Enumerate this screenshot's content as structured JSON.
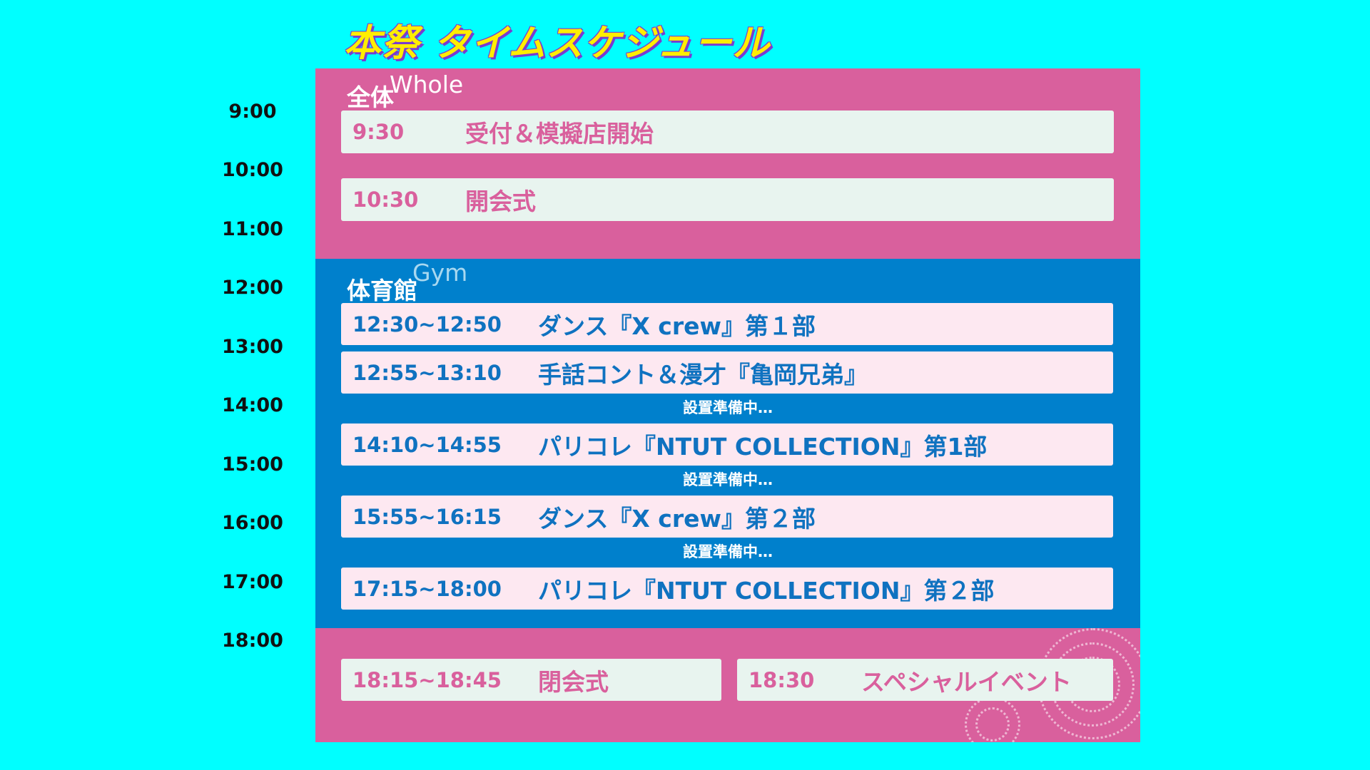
{
  "title": "本祭 タイムスケジュール",
  "hours": [
    "9:00",
    "10:00",
    "11:00",
    "12:00",
    "13:00",
    "14:00",
    "15:00",
    "16:00",
    "17:00",
    "18:00"
  ],
  "whole": {
    "label": "全体",
    "sublabel": "Whole",
    "events": [
      {
        "time": "9:30",
        "name": "受付＆模擬店開始"
      },
      {
        "time": "10:30",
        "name": "開会式"
      }
    ]
  },
  "gym": {
    "label": "体育館",
    "sublabel": "Gym",
    "events": [
      {
        "time": "12:30~12:50",
        "name": "ダンス『X crew』第１部"
      },
      {
        "time": "12:55~13:10",
        "name": "手話コント＆漫才『亀岡兄弟』"
      },
      {
        "time": "14:10~14:55",
        "name": "パリコレ『NTUT COLLECTION』第1部"
      },
      {
        "time": "15:55~16:15",
        "name": "ダンス『X crew』第２部"
      },
      {
        "time": "17:15~18:00",
        "name": "パリコレ『NTUT COLLECTION』第２部"
      }
    ],
    "setup_note": "設置準備中…"
  },
  "end": {
    "events": [
      {
        "time": "18:15~18:45",
        "name": "閉会式"
      },
      {
        "time": "18:30",
        "name": "スペシャルイベント"
      }
    ]
  },
  "colors": {
    "background": "#00ffff",
    "whole_section": "#d9609d",
    "gym_section": "#0080cc",
    "title_text": "#ffee00",
    "title_shadow": "#7a3bd0"
  }
}
